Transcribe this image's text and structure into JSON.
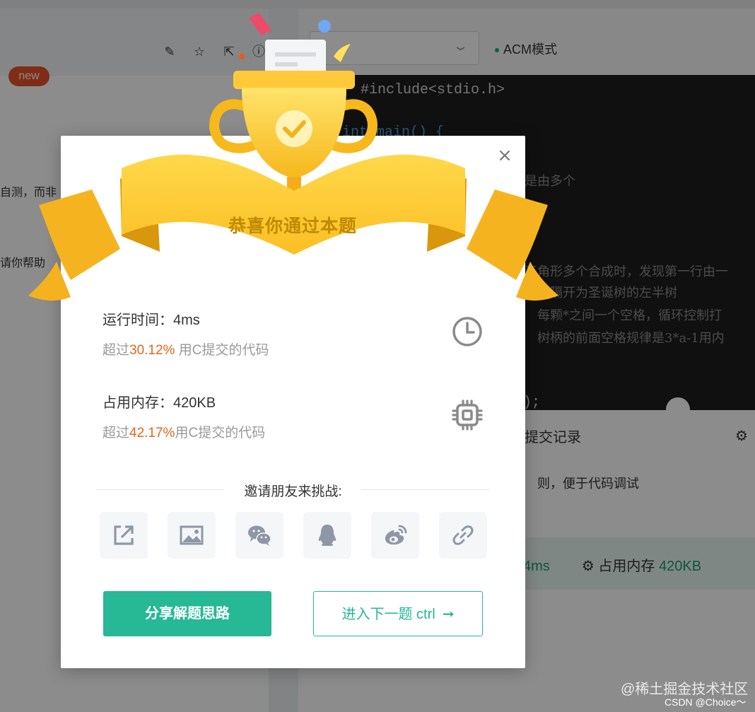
{
  "background": {
    "new_badge": "new",
    "left_text_1": "自测，而非",
    "left_text_2": "请你帮助",
    "mode_label": "ACM模式",
    "code_include": "#include<stdio.h>",
    "code_main": "int main() {",
    "code_comment_1": "是由多个",
    "code_comment_2": "三角形多个合成时，发现第一行由一",
    "code_comment_3": "号合隔开为圣诞树的左半树",
    "code_comment_4": "每颗*之间一个空格，循环控制打",
    "code_comment_5": "树柄的前面空格规律是3*a-1用内",
    "code_end": ");",
    "tab_records": "提交记录",
    "hint_text": "则，便于代码调试",
    "result_time": "4ms",
    "result_mem_label": "占用内存",
    "result_mem": "420KB"
  },
  "dialog": {
    "title": "恭喜你通过本题",
    "runtime": {
      "label": "运行时间：4ms",
      "prefix": "超过",
      "percent": "30.12%",
      "suffix": " 用C提交的代码"
    },
    "memory": {
      "label": "占用内存：420KB",
      "prefix": "超过",
      "percent": "42.17%",
      "suffix": "用C提交的代码"
    },
    "invite_title": "邀请朋友来挑战:",
    "share_buttons": [
      "share-external",
      "share-image",
      "share-wechat",
      "share-qq",
      "share-weibo",
      "share-link"
    ],
    "share_solution_label": "分享解题思路",
    "next_problem_label": "进入下一题 ctrl",
    "next_arrow": "➞"
  },
  "watermark": {
    "line1": "@稀土掘金技术社区",
    "line2": "CSDN @Choice～"
  },
  "colors": {
    "accent": "#27b895",
    "percent": "#e2661c",
    "gold": "#fcc42e"
  }
}
